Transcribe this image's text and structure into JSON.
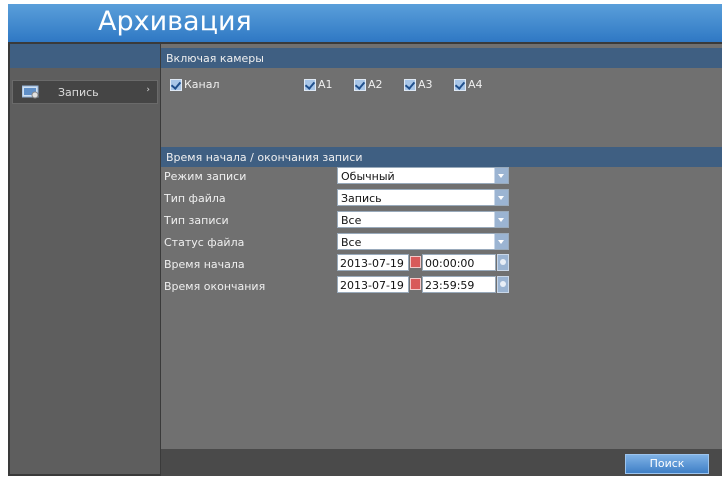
{
  "header": {
    "title": "Архивация"
  },
  "sidebar": {
    "items": [
      {
        "label": "Запись",
        "icon": "record-icon"
      }
    ]
  },
  "cameras": {
    "header": "Включая камеры",
    "items": [
      {
        "label": "Канал",
        "checked": true
      },
      {
        "label": "A1",
        "checked": true
      },
      {
        "label": "A2",
        "checked": true
      },
      {
        "label": "A3",
        "checked": true
      },
      {
        "label": "A4",
        "checked": true
      }
    ]
  },
  "time_section": {
    "header": "Время начала / окончания записи",
    "fields": [
      {
        "label": "Режим записи",
        "value": "Обычный"
      },
      {
        "label": "Тип файла",
        "value": "Запись"
      },
      {
        "label": "Тип записи",
        "value": "Все"
      },
      {
        "label": "Статус файла",
        "value": "Все"
      },
      {
        "label": "Время начала",
        "date": "2013-07-19",
        "time": "00:00:00"
      },
      {
        "label": "Время окончания",
        "date": "2013-07-19",
        "time": "23:59:59"
      }
    ]
  },
  "footer": {
    "search_label": "Поиск"
  },
  "colors": {
    "accent": "#3f7fc6",
    "header_bar": "#3f5f82",
    "panel": "#707070",
    "sidebar": "#5e5e5e"
  }
}
